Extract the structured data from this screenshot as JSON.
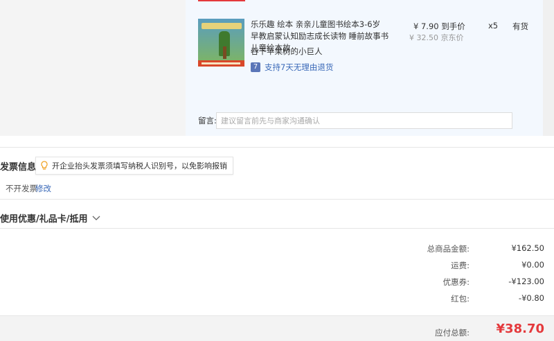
{
  "product": {
    "title": "乐乐趣 绘本 亲亲儿童图书绘本3-6岁 早教启蒙认知励志成长读物 睡前故事书 儿童绘本故",
    "subtitle": "吞下苹果树的小巨人",
    "return_policy": "支持7天无理由退货",
    "return_badge": "7",
    "price": "¥ 7.90 到手价",
    "original_price": "¥ 32.50 京东价",
    "quantity": "x5",
    "stock": "有货",
    "cover_color": "#c0462b"
  },
  "message": {
    "label": "留言:",
    "placeholder": "建议留言前先与商家沟通确认"
  },
  "invoice": {
    "title": "发票信息",
    "tip": "开企业抬头发票须填写纳税人识别号，以免影响报销",
    "status": "不开发票",
    "edit_label": "修改"
  },
  "coupon": {
    "title": "使用优惠/礼品卡/抵用"
  },
  "summary": {
    "rows": [
      {
        "label": "总商品金额:",
        "value": "¥162.50"
      },
      {
        "label": "运费:",
        "value": "¥0.00"
      },
      {
        "label": "优惠券:",
        "value": "-¥123.00"
      },
      {
        "label": "红包:",
        "value": "-¥0.80"
      }
    ],
    "payable_label": "应付总额:",
    "payable_value": "¥38.70"
  },
  "colors": {
    "accent_red": "#e4393c",
    "link_blue": "#3a69b8",
    "product_bg": "#f3f8fe"
  }
}
